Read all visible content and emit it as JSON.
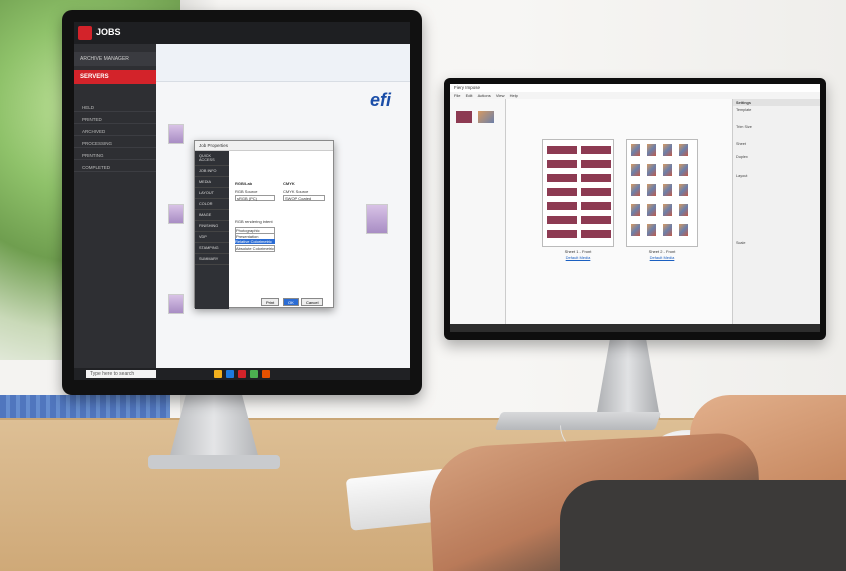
{
  "left_monitor": {
    "app_title": "JOBS",
    "archive_label": "ARCHIVE MANAGER",
    "servers_label": "SERVERS",
    "nav_items": [
      "HELD",
      "PRINTED",
      "ARCHIVED",
      "PROCESSING",
      "PRINTING",
      "COMPLETED"
    ],
    "efi_logo": "efi",
    "dialog": {
      "title": "Job Properties",
      "side_items": [
        "QUICK ACCESS",
        "JOB INFO",
        "MEDIA",
        "LAYOUT",
        "COLOR",
        "IMAGE",
        "FINISHING",
        "VDP",
        "STAMPING",
        "SUMMARY"
      ],
      "rgb_label": "RGB/Lab",
      "cmyk_label": "CMYK",
      "rgb_source_label": "RGB Source",
      "rgb_source_value": "sRGB (PC)",
      "cmyk_source_label": "CMYK Source",
      "cmyk_source_value": "SWOP Coated",
      "rendering_label": "RGB rendering intent",
      "rendering_options": [
        "Photographic",
        "Presentation",
        "Relative Colorimetric",
        "Absolute Colorimetric"
      ],
      "ok_label": "OK",
      "cancel_label": "Cancel",
      "print_label": "Print"
    },
    "taskbar_search": "Type here to search"
  },
  "right_monitor": {
    "title": "Fiery Impose",
    "menu": [
      "File",
      "Edit",
      "Actions",
      "View",
      "Help"
    ],
    "sheet_labels": [
      "Sheet 1 - Front",
      "Sheet 2 - Front"
    ],
    "sheet_links": [
      "Default Media",
      "Default Media"
    ],
    "settings_title": "Settings",
    "settings_rows": [
      "Template",
      "Trim Size",
      "Sheet",
      "Duplex",
      "Layout",
      "Scale"
    ]
  }
}
